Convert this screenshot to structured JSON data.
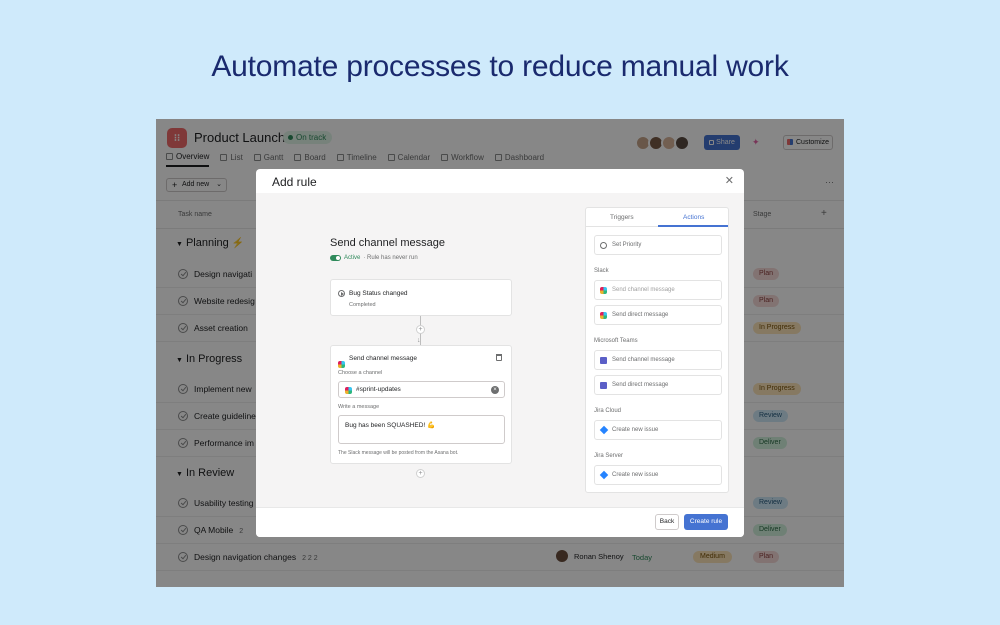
{
  "headline": "Automate processes to reduce manual work",
  "project": {
    "title": "Product Launch",
    "status": "On track",
    "tabs": [
      "Overview",
      "List",
      "Gantt",
      "Board",
      "Timeline",
      "Calendar",
      "Workflow",
      "Dashboard"
    ],
    "share_label": "Share",
    "customize_label": "Customize",
    "add_new_label": "Add new",
    "filter_label": "F"
  },
  "table": {
    "col_task": "Task name",
    "col_stage": "Stage",
    "sections": [
      {
        "title": "Planning",
        "rows": [
          {
            "name": "Design navigati",
            "meta": "",
            "stage": "Plan"
          },
          {
            "name": "Website redesig",
            "meta": "",
            "stage": "Plan"
          },
          {
            "name": "Asset creation",
            "meta": "",
            "stage": "In Progress"
          }
        ]
      },
      {
        "title": "In Progress",
        "rows": [
          {
            "name": "Implement new",
            "meta": "",
            "stage": "In Progress"
          },
          {
            "name": "Create guideline",
            "meta": "",
            "stage": "Review"
          },
          {
            "name": "Performance im",
            "meta": "",
            "stage": "Deliver"
          }
        ]
      },
      {
        "title": "In Review",
        "rows": [
          {
            "name": "Usability testing",
            "meta": "",
            "stage": "Review"
          },
          {
            "name": "QA Mobile",
            "meta": "2",
            "stage": "Deliver"
          },
          {
            "name": "Design navigation changes",
            "meta": "2  2  2",
            "stage": "Plan",
            "assignee": "Ronan Shenoy",
            "due": "Today",
            "priority": "Medium"
          }
        ]
      }
    ]
  },
  "modal": {
    "title": "Add rule",
    "rule_title": "Send channel message",
    "rule_active": "Active",
    "rule_status": "· Rule has never run",
    "trigger": {
      "title": "Bug Status changed",
      "sub": "Completed"
    },
    "action": {
      "title": "Send channel message",
      "channel_label": "Choose a channel",
      "channel_value": "#sprint-updates",
      "message_label": "Write a message",
      "message_value": "Bug has been SQUASHED! 💪",
      "hint": "The Slack message will be posted from the Asana bot."
    },
    "panel": {
      "tab_triggers": "Triggers",
      "tab_actions": "Actions",
      "set_priority": "Set Priority",
      "groups": [
        {
          "heading": "Slack",
          "items": [
            "Send channel message",
            "Send direct message"
          ]
        },
        {
          "heading": "Microsoft Teams",
          "items": [
            "Send channel message",
            "Send direct message"
          ]
        },
        {
          "heading": "Jira Cloud",
          "items": [
            "Create new issue"
          ]
        },
        {
          "heading": "Jira Server",
          "items": [
            "Create new issue"
          ]
        }
      ]
    },
    "back_label": "Back",
    "create_label": "Create rule"
  }
}
